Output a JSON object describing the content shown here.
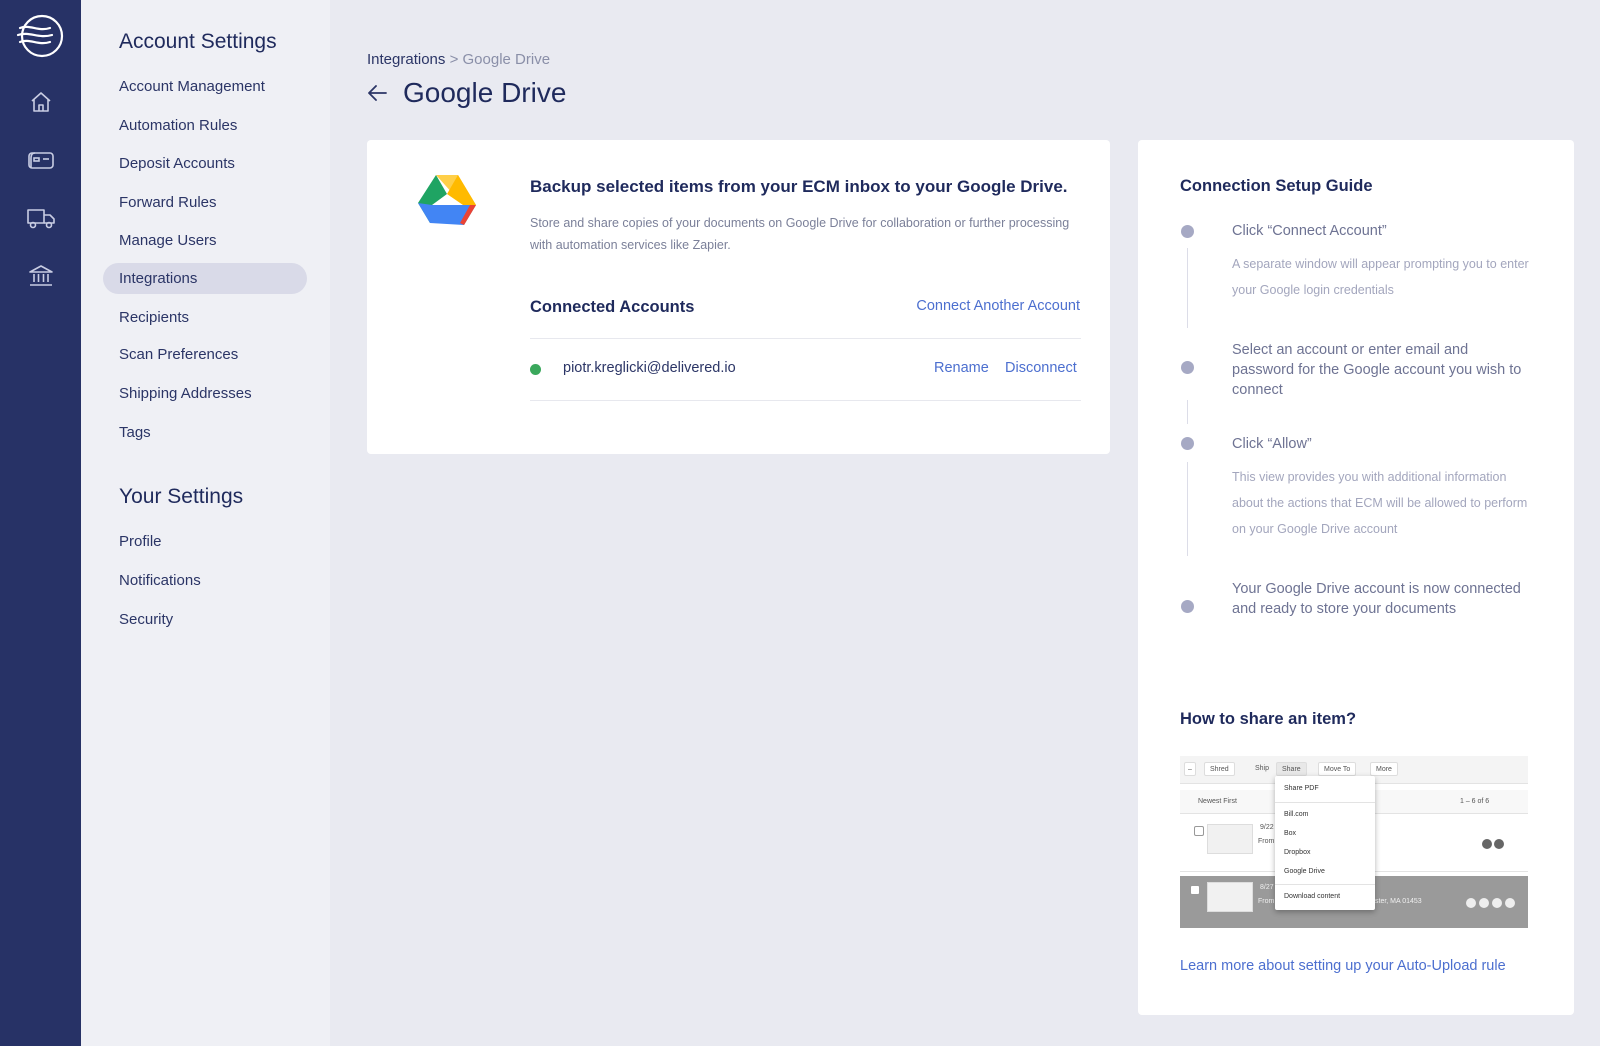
{
  "rail": {
    "items": [
      "home",
      "inbox",
      "shipping",
      "bank"
    ]
  },
  "sidebar": {
    "account_heading": "Account Settings",
    "account_items": [
      {
        "label": "Account Management"
      },
      {
        "label": "Automation Rules"
      },
      {
        "label": "Deposit Accounts"
      },
      {
        "label": "Forward Rules"
      },
      {
        "label": "Manage Users"
      },
      {
        "label": "Integrations",
        "active": true
      },
      {
        "label": "Recipients"
      },
      {
        "label": "Scan Preferences"
      },
      {
        "label": "Shipping Addresses"
      },
      {
        "label": "Tags"
      }
    ],
    "your_heading": "Your Settings",
    "your_items": [
      {
        "label": "Profile"
      },
      {
        "label": "Notifications"
      },
      {
        "label": "Security"
      }
    ]
  },
  "breadcrumb": {
    "parent": "Integrations",
    "separator": ">",
    "current": "Google Drive"
  },
  "page": {
    "title": "Google Drive"
  },
  "integration": {
    "headline": "Backup selected items from your ECM inbox to your Google Drive.",
    "description": "Store and share copies of your documents on Google Drive for collaboration or further processing with automation services like Zapier.",
    "connected_title": "Connected Accounts",
    "connect_link": "Connect Another Account",
    "accounts": [
      {
        "email": "piotr.kreglicki@delivered.io",
        "status_color": "#3aa85c",
        "rename": "Rename",
        "disconnect": "Disconnect"
      }
    ]
  },
  "guide": {
    "title": "Connection Setup Guide",
    "steps": [
      {
        "title": "Click “Connect Account”",
        "desc": "A separate window will appear prompting you to enter your Google login credentials"
      },
      {
        "title": "Select an account or enter email and password for the Google account you wish to connect",
        "desc": ""
      },
      {
        "title": "Click “Allow”",
        "desc": "This view provides you with additional information about the actions that ECM will be allowed to perform on your Google Drive account"
      },
      {
        "title": "Your Google Drive account is now connected and ready to store your documents",
        "desc": ""
      }
    ],
    "share_title": "How to share an item?",
    "screenshot": {
      "toolbar": [
        "Shred",
        "Ship",
        "Share",
        "Move To",
        "More"
      ],
      "sort": "Newest First",
      "paging": "1 – 6 of 6",
      "menu": [
        "Share PDF",
        "Bill.com",
        "Box",
        "Dropbox",
        "Google Drive",
        "Download content"
      ],
      "row1_date": "9/22",
      "row1_from": "From",
      "row2_date": "8/27",
      "row2_from": "From",
      "row2_address": "ster, MA 01453"
    },
    "learn_link": "Learn more about setting up your Auto-Upload rule"
  },
  "colors": {
    "rail": "#273266",
    "accent_link": "#4c6fcf",
    "status_connected": "#3aa85c"
  }
}
